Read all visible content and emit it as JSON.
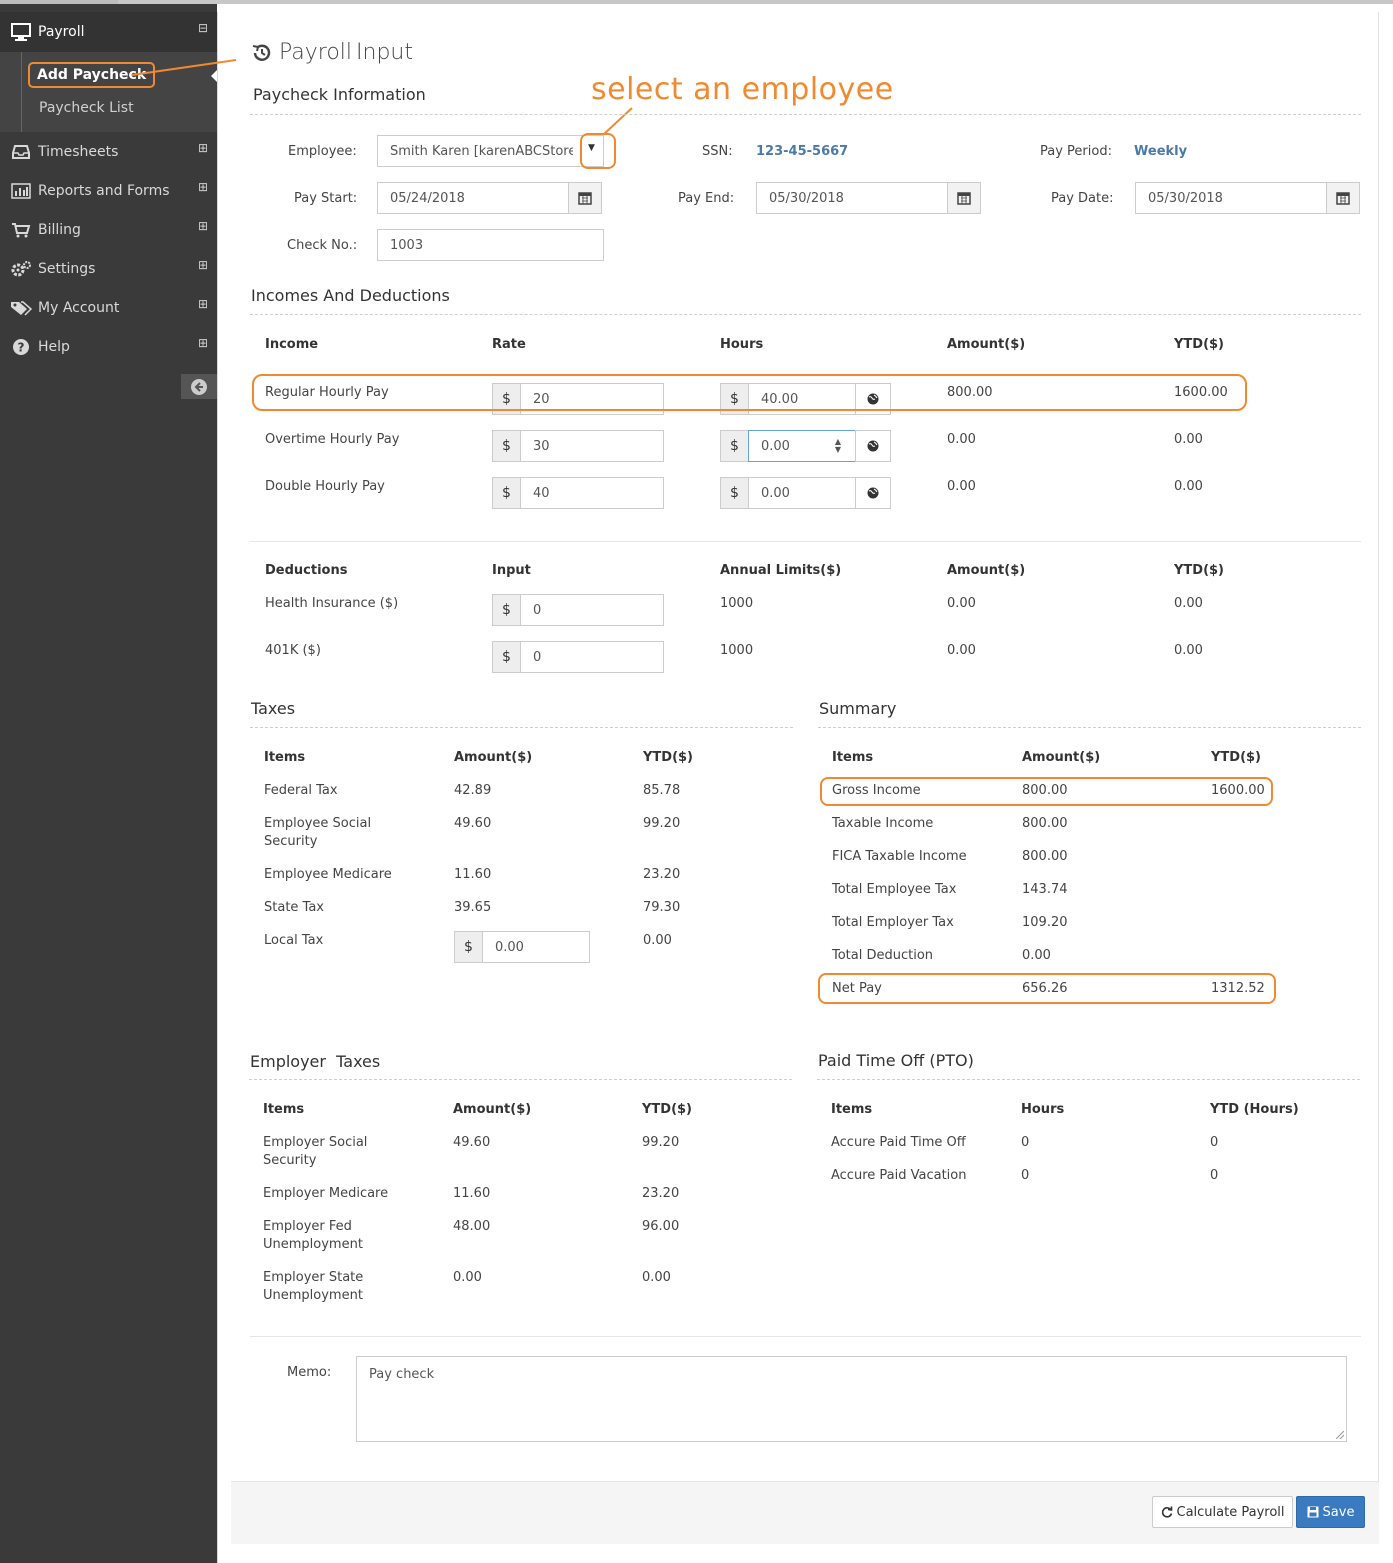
{
  "sidebar": {
    "header": "Payroll",
    "subitems": [
      "Add Paycheck",
      "Paycheck List"
    ],
    "items": [
      "Timesheets",
      "Reports and Forms",
      "Billing",
      "Settings",
      "My Account",
      "Help"
    ],
    "expand_glyph": "⊞",
    "collapse_glyph": "⊟"
  },
  "page": {
    "title_a": "Payroll",
    "title_b": "Input",
    "annotation": "select an employee"
  },
  "paycheck_info": {
    "section_title": "Paycheck Information",
    "employee_label": "Employee:",
    "employee_value": "Smith Karen [karenABCStore@",
    "ssn_label": "SSN:",
    "ssn_value": "123-45-5667",
    "pay_period_label": "Pay Period:",
    "pay_period_value": "Weekly",
    "pay_start_label": "Pay Start:",
    "pay_start_value": "05/24/2018",
    "pay_end_label": "Pay End:",
    "pay_end_value": "05/30/2018",
    "pay_date_label": "Pay Date:",
    "pay_date_value": "05/30/2018",
    "check_no_label": "Check No.:",
    "check_no_value": "1003"
  },
  "incomes": {
    "section_title": "Incomes And Deductions",
    "headers": [
      "Income",
      "Rate",
      "Hours",
      "Amount($)",
      "YTD($)"
    ],
    "rows": [
      {
        "name": "Regular Hourly Pay",
        "rate": "20",
        "hours": "40.00",
        "amount": "800.00",
        "ytd": "1600.00"
      },
      {
        "name": "Overtime Hourly Pay",
        "rate": "30",
        "hours": "0.00",
        "amount": "0.00",
        "ytd": "0.00"
      },
      {
        "name": "Double Hourly Pay",
        "rate": "40",
        "hours": "0.00",
        "amount": "0.00",
        "ytd": "0.00"
      }
    ],
    "currency": "$"
  },
  "deductions": {
    "headers": [
      "Deductions",
      "Input",
      "Annual Limits($)",
      "Amount($)",
      "YTD($)"
    ],
    "rows": [
      {
        "name": "Health Insurance ($)",
        "input": "0",
        "limit": "1000",
        "amount": "0.00",
        "ytd": "0.00"
      },
      {
        "name": "401K ($)",
        "input": "0",
        "limit": "1000",
        "amount": "0.00",
        "ytd": "0.00"
      }
    ]
  },
  "taxes": {
    "section_title": "Taxes",
    "headers": [
      "Items",
      "Amount($)",
      "YTD($)"
    ],
    "rows": [
      {
        "name": "Federal Tax",
        "amount": "42.89",
        "ytd": "85.78"
      },
      {
        "name": "Employee Social Security",
        "amount": "49.60",
        "ytd": "99.20"
      },
      {
        "name": "Employee Medicare",
        "amount": "11.60",
        "ytd": "23.20"
      },
      {
        "name": "State Tax",
        "amount": "39.65",
        "ytd": "79.30"
      },
      {
        "name": "Local Tax",
        "amount": "0.00",
        "ytd": "0.00"
      }
    ]
  },
  "summary": {
    "section_title": "Summary",
    "headers": [
      "Items",
      "Amount($)",
      "YTD($)"
    ],
    "rows": [
      {
        "name": "Gross Income",
        "amount": "800.00",
        "ytd": "1600.00"
      },
      {
        "name": "Taxable Income",
        "amount": "800.00",
        "ytd": ""
      },
      {
        "name": "FICA Taxable Income",
        "amount": "800.00",
        "ytd": ""
      },
      {
        "name": "Total Employee Tax",
        "amount": "143.74",
        "ytd": ""
      },
      {
        "name": "Total Employer Tax",
        "amount": "109.20",
        "ytd": ""
      },
      {
        "name": "Total Deduction",
        "amount": "0.00",
        "ytd": ""
      },
      {
        "name": "Net Pay",
        "amount": "656.26",
        "ytd": "1312.52"
      }
    ]
  },
  "employer_taxes": {
    "section_title": "Employer  Taxes",
    "headers": [
      "Items",
      "Amount($)",
      "YTD($)"
    ],
    "rows": [
      {
        "name": "Employer Social Security",
        "amount": "49.60",
        "ytd": "99.20"
      },
      {
        "name": "Employer Medicare",
        "amount": "11.60",
        "ytd": "23.20"
      },
      {
        "name": "Employer Fed Unemployment",
        "amount": "48.00",
        "ytd": "96.00"
      },
      {
        "name": "Employer State Unemployment",
        "amount": "0.00",
        "ytd": "0.00"
      }
    ]
  },
  "pto": {
    "section_title": "Paid Time Off (PTO)",
    "headers": [
      "Items",
      "Hours",
      "YTD (Hours)"
    ],
    "rows": [
      {
        "name": "Accure Paid Time Off",
        "hours": "0",
        "ytd": "0"
      },
      {
        "name": "Accure Paid Vacation",
        "hours": "0",
        "ytd": "0"
      }
    ]
  },
  "memo": {
    "label": "Memo:",
    "value": "Pay check"
  },
  "actions": {
    "calculate": "Calculate Payroll",
    "save": "Save"
  },
  "colors": {
    "accent": "#f08a30",
    "primary": "#3a7ac0",
    "link": "#4a7aa7",
    "sidebar": "#3a3a3a"
  }
}
